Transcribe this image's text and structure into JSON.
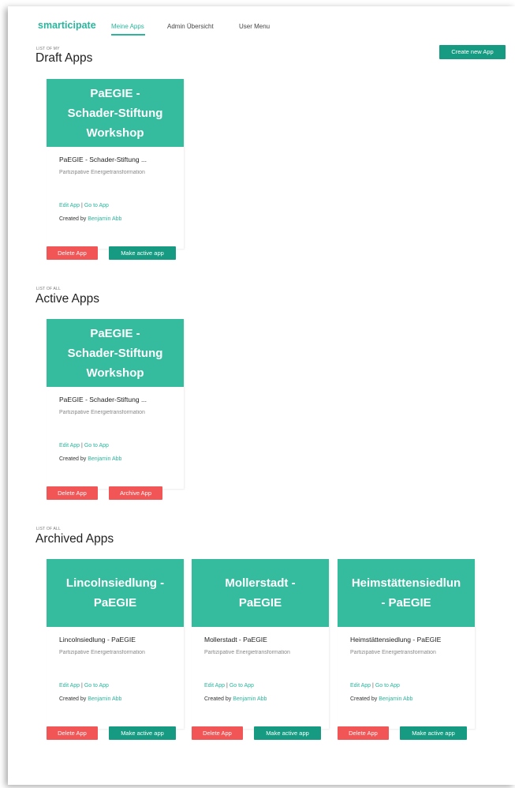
{
  "nav": {
    "brand": "smarticipate",
    "items": [
      "Meine Apps",
      "Admin Übersicht",
      "User Menu"
    ]
  },
  "create_button": "Create new App",
  "sections": {
    "draft": {
      "label": "LIST OF MY",
      "title": "Draft Apps"
    },
    "active": {
      "label": "LIST OF ALL",
      "title": "Active Apps"
    },
    "archived": {
      "label": "LIST OF ALL",
      "title": "Archived Apps"
    }
  },
  "cards": {
    "draft0": {
      "head": [
        "PaEGIE -",
        "Schader-Stiftung",
        "Workshop"
      ],
      "name": "PaEGIE - Schader-Stiftung ...",
      "subtitle": "Partizipative Energietransformation",
      "edit": "Edit App",
      "sep": "|",
      "goto": "Go to App",
      "created_prefix": "Created by",
      "author": "Benjamin Abb",
      "btn1": "Delete App",
      "btn2": "Make active app"
    },
    "active0": {
      "head": [
        "PaEGIE -",
        "Schader-Stiftung",
        "Workshop"
      ],
      "name": "PaEGIE - Schader-Stiftung ...",
      "subtitle": "Partizipative Energietransformation",
      "edit": "Edit App",
      "sep": "|",
      "goto": "Go to App",
      "created_prefix": "Created by",
      "author": "Benjamin Abb",
      "btn1": "Delete App",
      "btn2": "Archive App"
    },
    "archived0": {
      "head": [
        "Lincolnsiedlung -",
        "PaEGIE"
      ],
      "name": "Lincolnsiedlung - PaEGIE",
      "subtitle": "Partizipative Energietransformation",
      "edit": "Edit App",
      "sep": "|",
      "goto": "Go to App",
      "created_prefix": "Created by",
      "author": "Benjamin Abb",
      "btn1": "Delete App",
      "btn2": "Make active app"
    },
    "archived1": {
      "head": [
        "Mollerstadt -",
        "PaEGIE"
      ],
      "name": "Mollerstadt - PaEGIE",
      "subtitle": "Partizipative Energietransformation",
      "edit": "Edit App",
      "sep": "|",
      "goto": "Go to App",
      "created_prefix": "Created by",
      "author": "Benjamin Abb",
      "btn1": "Delete App",
      "btn2": "Make active app"
    },
    "archived2": {
      "head": [
        "Heimstättensiedlun",
        "- PaEGIE"
      ],
      "name": "Heimstättensiedlung - PaEGIE",
      "subtitle": "Partizipative Energietransformation",
      "edit": "Edit App",
      "sep": "|",
      "goto": "Go to App",
      "created_prefix": "Created by",
      "author": "Benjamin Abb",
      "btn1": "Delete App",
      "btn2": "Make active app"
    }
  },
  "colors": {
    "accent": "#2bb59d",
    "card_header": "#35bc9f",
    "primary_button": "#169b82",
    "danger_button": "#f15555"
  }
}
